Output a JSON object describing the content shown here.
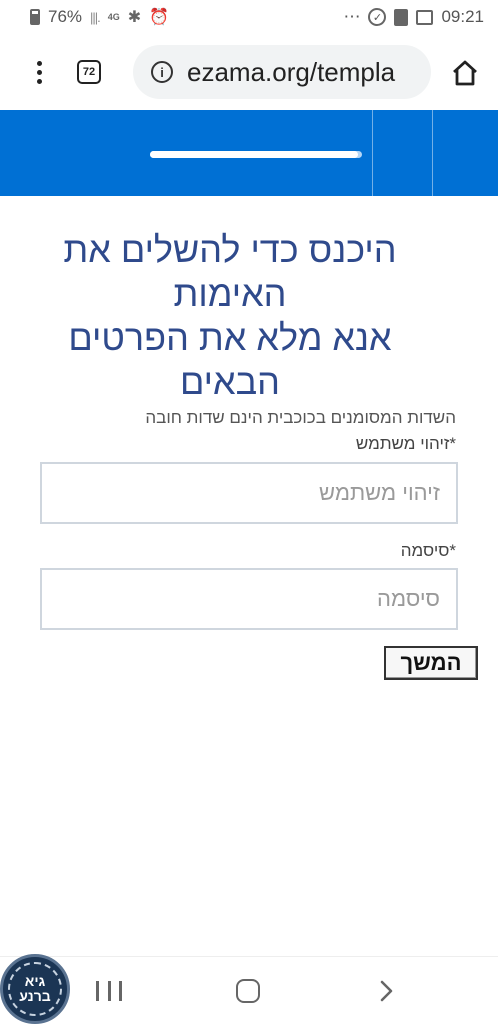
{
  "status_bar": {
    "battery": "76%",
    "network": "4G",
    "time": "09:21",
    "more": "⋯",
    "icons": [
      "battery-icon",
      "signal-icon",
      "bluetooth-icon",
      "alarm-icon",
      "check-circle-icon",
      "document-icon",
      "image-icon"
    ]
  },
  "browser": {
    "tab_count": "72",
    "url": "ezama.org/templa",
    "icons": [
      "menu-dots-icon",
      "tabs-counter-icon",
      "info-icon",
      "home-icon"
    ]
  },
  "banner": {
    "color": "#0070d4",
    "progress": 0.98
  },
  "form": {
    "heading_lines": [
      "היכנס כדי להשלים את",
      "האימות",
      "אנא מלא את הפרטים",
      "הבאים"
    ],
    "required_note": "השדות המסומנים בכוכבית הינם שדות חובה",
    "username_label": "*זיהוי משתמש",
    "username_placeholder": "זיהוי משתמש",
    "username_value": "",
    "password_label": "*סיסמה",
    "password_placeholder": "סיסמה",
    "password_value": "",
    "continue_label": "המשך",
    "heading_color": "#2f4a8c"
  },
  "nav_bar": {
    "icons": [
      "recent-apps-icon",
      "home-button-icon",
      "back-icon"
    ]
  },
  "overlay_logo": {
    "text_line1": "גיא",
    "text_line2": "ברנע"
  }
}
